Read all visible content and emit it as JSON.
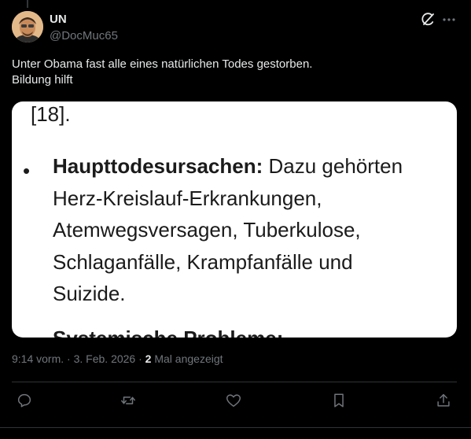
{
  "author": {
    "display_name": "UN",
    "handle": "@DocMuc65"
  },
  "tweet": {
    "text_lines": [
      "Unter Obama fast alle eines natürlichen Todes gestorben.",
      "Bildung hilft"
    ]
  },
  "media": {
    "ref": "[18].",
    "bullet_char": "•",
    "bullet_lead": "Haupttodesursachen:",
    "bullet_lines": [
      " Dazu gehörten",
      "Herz-Kreislauf-Erkrankungen,",
      "Atemwegsversagen, Tuberkulose,",
      "Schlaganfälle, Krampfanfälle und",
      "Suizide."
    ],
    "cut_heading": "Systemische Probleme:"
  },
  "meta": {
    "time": "9:14 vorm.",
    "separator": "·",
    "date": "3. Feb. 2026",
    "views_count": "2",
    "views_label": "Mal angezeigt"
  },
  "icons": {
    "grok": "grok-icon",
    "more": "more-icon",
    "reply": "reply-icon",
    "repost": "repost-icon",
    "like": "heart-icon",
    "bookmark": "bookmark-icon",
    "share": "share-icon"
  },
  "colors": {
    "background": "#000000",
    "text_primary": "#e7e9ea",
    "text_secondary": "#71767b",
    "divider": "#2f3336",
    "card": "#ffffff"
  }
}
